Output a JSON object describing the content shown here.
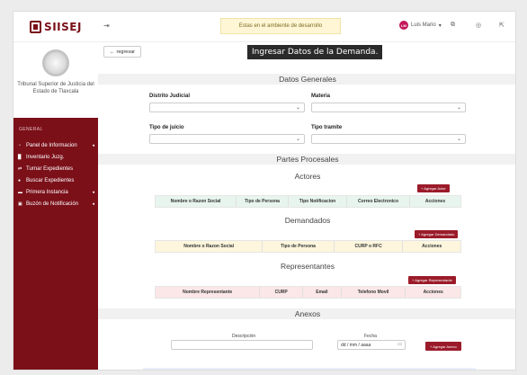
{
  "app": {
    "logo_text": "SIISEJ",
    "institution": "Tribunal Superior de Justicia del Estado de Tlaxcala"
  },
  "topbar": {
    "environment_notice": "Estas en el ambiente de desarrollo",
    "user_initials": "LM",
    "user_name": "Luis Mario",
    "icons": [
      "collapse-icon",
      "window-icon",
      "help-icon",
      "logout-icon"
    ]
  },
  "sidebar": {
    "section": "GENERAL",
    "items": [
      {
        "label": "Panel de Informacion",
        "icon": "dashboard-icon",
        "has_submenu": true
      },
      {
        "label": "Inventario Juzg.",
        "icon": "document-icon",
        "has_submenu": false
      },
      {
        "label": "Turnar Expedientes",
        "icon": "arrows-icon",
        "has_submenu": false
      },
      {
        "label": "Buscar Expedientes",
        "icon": "search-icon",
        "has_submenu": false
      },
      {
        "label": "Primera Instancia",
        "icon": "folder-icon",
        "has_submenu": true
      },
      {
        "label": "Buzón de Notificación",
        "icon": "inbox-icon",
        "has_submenu": true
      }
    ]
  },
  "main": {
    "back_label": "regresar",
    "title": "Ingresar Datos de la Demanda.",
    "datos_generales": {
      "title": "Datos Generales",
      "distrito_label": "Distrito Judicial",
      "materia_label": "Materia",
      "tipo_juicio_label": "Tipo de juicio",
      "tipo_tramite_label": "Tipo tramite"
    },
    "partes_procesales": {
      "title": "Partes Procesales",
      "actores": {
        "title": "Actores",
        "add_label": "+ Agregar Actor",
        "columns": [
          "Nombre o Razon Social",
          "Tipo de Persona",
          "Tipo Notificacion",
          "Correo Electronico",
          "Acciones"
        ]
      },
      "demandados": {
        "title": "Demandados",
        "add_label": "+ Agregar Demandado",
        "columns": [
          "Nombre o Razon Social",
          "Tipo de Persona",
          "CURP o RFC",
          "Acciones"
        ]
      },
      "representantes": {
        "title": "Representantes",
        "add_label": "+ Agregar Representante",
        "columns": [
          "Nombre Representante",
          "CURP",
          "Email",
          "Telefono Movil",
          "Acciones"
        ]
      }
    },
    "anexos": {
      "title": "Anexos",
      "descripcion_label": "Descripción",
      "fecha_label": "Fecha",
      "fecha_placeholder": "dd / mm / aaaa",
      "add_label": "+ Agregar Anexo"
    }
  },
  "colors": {
    "brand": "#7b1019",
    "accent_button": "#9b1b2a",
    "notice_bg": "#fff6d6"
  }
}
